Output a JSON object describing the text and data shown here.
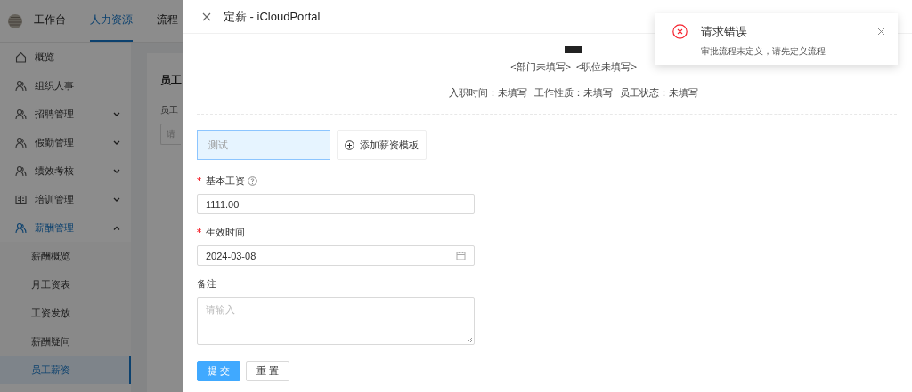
{
  "header": {
    "tabs": [
      {
        "label": "工作台",
        "selected": false
      },
      {
        "label": "人力资源",
        "selected": true
      },
      {
        "label": "流程",
        "selected": false
      }
    ]
  },
  "sidebar": {
    "items": [
      {
        "label": "概览",
        "kind": "home",
        "selected": false
      },
      {
        "label": "组织人事",
        "kind": "people",
        "selected": false
      },
      {
        "label": "招聘管理",
        "kind": "people",
        "expanded": false,
        "selected": false
      },
      {
        "label": "假勤管理",
        "kind": "people",
        "expanded": false,
        "selected": false
      },
      {
        "label": "绩效考核",
        "kind": "people",
        "expanded": false,
        "selected": false
      },
      {
        "label": "培训管理",
        "kind": "book",
        "expanded": false,
        "selected": false
      },
      {
        "label": "薪酬管理",
        "kind": "people",
        "expanded": true,
        "selected": true,
        "children": [
          {
            "label": "薪酬概览",
            "selected": false
          },
          {
            "label": "月工资表",
            "selected": false
          },
          {
            "label": "工资发放",
            "selected": false
          },
          {
            "label": "薪酬疑问",
            "selected": false
          },
          {
            "label": "员工薪资",
            "selected": true
          }
        ]
      }
    ]
  },
  "page": {
    "title": "员工",
    "filter_label": "员工",
    "search_placeholder": "请"
  },
  "drawer": {
    "title": "定薪 - iCloudPortal",
    "profile": {
      "org": [
        "<部门未填写>",
        "<职位未填写>"
      ],
      "facts": [
        "入职时间：未填写",
        "工作性质：未填写",
        "员工状态：未填写"
      ]
    },
    "templates": [
      {
        "label": "测试",
        "selected": true
      }
    ],
    "add_template": "添加薪资模板",
    "fields": [
      {
        "kind": "number",
        "label": "基本工资",
        "required": true,
        "help": true,
        "value": "1111.00"
      },
      {
        "kind": "date",
        "label": "生效时间",
        "required": true,
        "help": false,
        "value": "2024-03-08"
      },
      {
        "kind": "textarea",
        "label": "备注",
        "required": false,
        "help": false,
        "placeholder": "请输入"
      }
    ],
    "buttons": [
      {
        "label": "提交",
        "kind": "primary"
      },
      {
        "label": "重置",
        "kind": "default"
      }
    ]
  },
  "toast": {
    "title": "请求错误",
    "message": "审批流程未定义，请先定义流程"
  }
}
